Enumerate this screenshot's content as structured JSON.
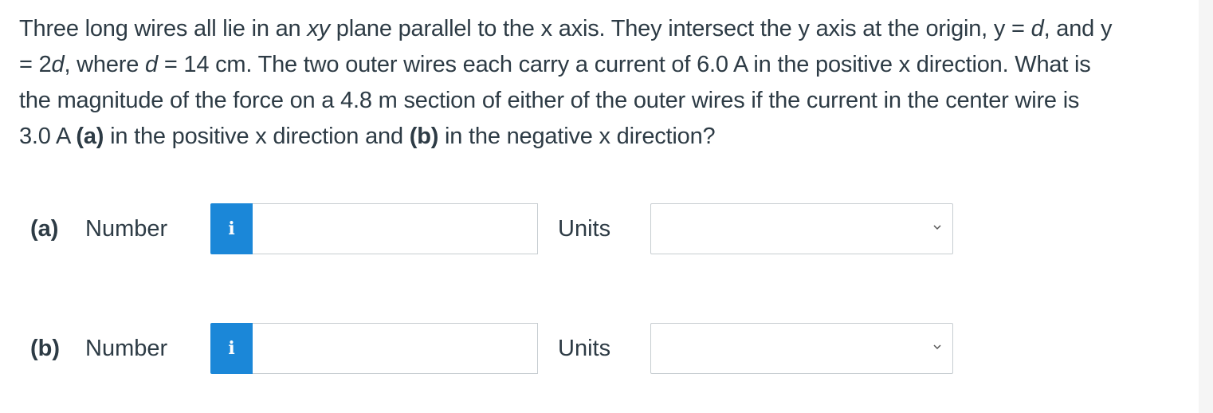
{
  "question": {
    "line1_a": "Three long wires all lie in an ",
    "line1_xy": "xy",
    "line1_b": " plane parallel to the x axis. They intersect the y axis at the origin, y = ",
    "line1_d": "d",
    "line1_c": ", and y",
    "line2_a": "= 2",
    "line2_d": "d",
    "line2_b": ", where ",
    "line2_d2": "d",
    "line2_c": " = 14 cm. The two outer wires each carry a current of 6.0 A in the positive x direction. What is",
    "line3": "the magnitude of the force on a 4.8 m section of either of the outer wires if the current in the center wire is",
    "line4_a": "3.0 A ",
    "line4_pa": "(a)",
    "line4_b": " in the positive x direction and ",
    "line4_pb": "(b)",
    "line4_c": " in the negative x direction?"
  },
  "parts": [
    {
      "label": "(a)",
      "number_label": "Number",
      "info_glyph": "i",
      "number_value": "",
      "units_label": "Units",
      "units_selected": ""
    },
    {
      "label": "(b)",
      "number_label": "Number",
      "info_glyph": "i",
      "number_value": "",
      "units_label": "Units",
      "units_selected": ""
    }
  ],
  "icons": {
    "info": "info-icon",
    "dropdown": "chevron-down-icon"
  },
  "colors": {
    "info_button": "#1b87d8",
    "text": "#2d3b45",
    "border": "#c7cdd1"
  }
}
